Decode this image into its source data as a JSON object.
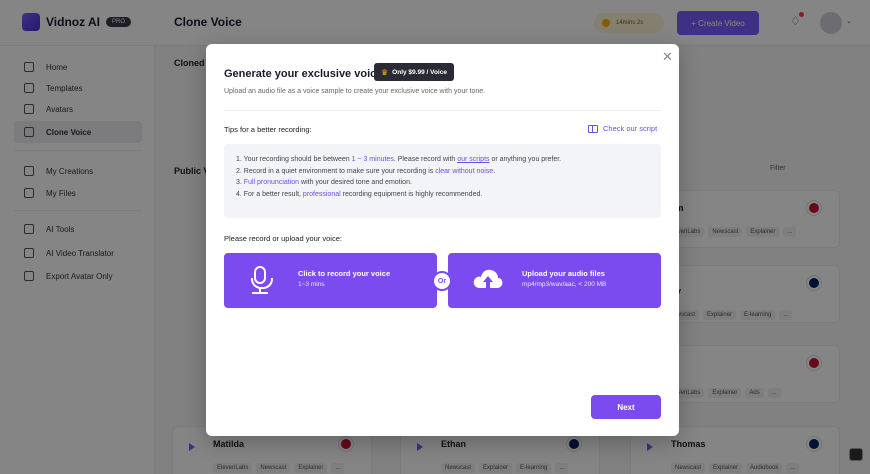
{
  "app": {
    "logo_text": "Vidnoz AI",
    "pro_badge": "PRO",
    "page_title": "Clone Voice",
    "time_remaining": "14mins 2s",
    "create_video_label": "+ Create Video"
  },
  "sidebar": {
    "items": [
      {
        "label": "Home",
        "icon": "home-icon"
      },
      {
        "label": "Templates",
        "icon": "templates-icon"
      },
      {
        "label": "Avatars",
        "icon": "avatars-icon"
      },
      {
        "label": "Clone Voice",
        "icon": "clone-voice-icon",
        "active": true
      },
      {
        "label": "My Creations",
        "icon": "play-icon"
      },
      {
        "label": "My Files",
        "icon": "cloud-icon"
      },
      {
        "label": "AI Tools",
        "icon": "tools-icon"
      },
      {
        "label": "AI Video Translator",
        "icon": "translate-icon"
      },
      {
        "label": "Export Avatar Only",
        "icon": "avatar-export-icon"
      }
    ]
  },
  "background": {
    "cloned_label": "Cloned",
    "public_label": "Public V",
    "filter_label": "Filter",
    "voice_cards": [
      {
        "name": "llum",
        "tags": [
          "ElevenLabs",
          "Newscast",
          "Explainer",
          "..."
        ]
      },
      {
        "name": "oby",
        "tags": [
          "Newscast",
          "Explainer",
          "E-learning",
          "..."
        ]
      },
      {
        "name": "l",
        "tags": [
          "ElevenLabs",
          "Explainer",
          "Ads",
          "..."
        ]
      },
      {
        "name": "Matilda",
        "tags": [
          "ElevenLabs",
          "Newscast",
          "Explainer",
          "..."
        ]
      },
      {
        "name": "Ethan",
        "tags": [
          "Newscast",
          "Explainer",
          "E-learning",
          "..."
        ]
      },
      {
        "name": "Thomas",
        "tags": [
          "Newscast",
          "Explainer",
          "Audiobook",
          "..."
        ]
      }
    ]
  },
  "modal": {
    "title": "Generate your exclusive voice",
    "price_badge": "Only $9.99 / Voice",
    "subtitle": "Upload an audio file as a voice sample to create your exclusive voice with your tone.",
    "tips_title": "Tips for a better recording:",
    "script_link": "Check our script",
    "tips": {
      "t1_a": "1. Your recording should be between ",
      "t1_b": "1 ~ 3 minutes",
      "t1_c": ". Please record with ",
      "t1_d": "our scripts",
      "t1_e": " or anything you prefer.",
      "t2_a": "2. Record in a quiet environment to make sure your recording is ",
      "t2_b": "clear without noise",
      "t2_c": ".",
      "t3_a": "3. ",
      "t3_b": "Full pronunciation",
      "t3_c": " with your desired tone and emotion.",
      "t4_a": "4. For a better result, ",
      "t4_b": "professional",
      "t4_c": " recording equipment is highly recommended."
    },
    "upload_title": "Please record or upload your voice:",
    "record_button": {
      "title": "Click to record your voice",
      "sub": "1~3 mins"
    },
    "or_label": "Or",
    "upload_button": {
      "title": "Upload your audio files",
      "sub": "mp4/mp3/wav/aac, < 200 MB"
    },
    "next_label": "Next"
  },
  "colors": {
    "accent": "#7b4bf0",
    "overlay": "rgba(0,0,0,0.48)"
  }
}
